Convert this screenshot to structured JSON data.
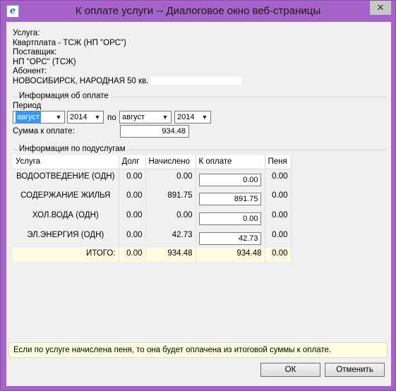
{
  "window": {
    "title": "К оплате услуги -- Диалоговое окно веб-страницы",
    "close_symbol": "✕"
  },
  "provider": {
    "service_label": "Услуга:",
    "service_value": "Квартплата - ТСЖ (НП \"ОРС\")",
    "supplier_label": "Поставщик:",
    "supplier_value": "НП \"ОРС\" (ТСЖ)",
    "subscriber_label": "Абонент:",
    "subscriber_value": "НОВОСИБИРСК, НАРОДНАЯ 50 кв."
  },
  "payment": {
    "section_title": "Информация об оплате",
    "period_label": "Период",
    "month_from": "август",
    "year_from": "2014",
    "to_label": "по",
    "month_to": "август",
    "year_to": "2014",
    "amount_label": "Сумма к оплате:",
    "amount_value": "934.48"
  },
  "subservices": {
    "section_title": "Информация по подуслугам",
    "headers": {
      "service": "Услуга",
      "debt": "Долг",
      "accrued": "Начислено",
      "to_pay": "К оплате",
      "penalty": "Пеня"
    },
    "rows": [
      {
        "service": "ВОДООТВЕДЕНИЕ (ОДН)",
        "debt": "0.00",
        "accrued": "0.00",
        "to_pay": "0.00",
        "penalty": "0.00"
      },
      {
        "service": "СОДЕРЖАНИЕ ЖИЛЬЯ",
        "debt": "0.00",
        "accrued": "891.75",
        "to_pay": "891.75",
        "penalty": "0.00"
      },
      {
        "service": "ХОЛ.ВОДА (ОДН)",
        "debt": "0.00",
        "accrued": "0.00",
        "to_pay": "0.00",
        "penalty": "0.00"
      },
      {
        "service": "ЭЛ.ЭНЕРГИЯ (ОДН)",
        "debt": "0.00",
        "accrued": "42.73",
        "to_pay": "42.73",
        "penalty": "0.00"
      }
    ],
    "total": {
      "service": "ИТОГО:",
      "debt": "0.00",
      "accrued": "934.48",
      "to_pay": "934.48",
      "penalty": "0.00"
    }
  },
  "info_message": "Если по услуге начислена пеня, то она будет оплачена из итоговой суммы к оплате.",
  "buttons": {
    "ok": "ОК",
    "cancel": "Отменить"
  }
}
